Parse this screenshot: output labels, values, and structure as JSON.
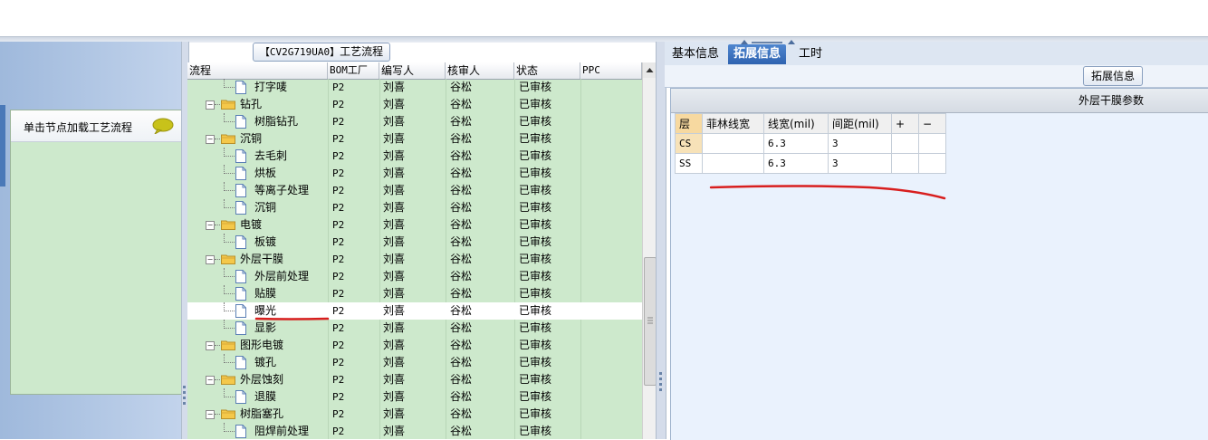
{
  "middle": {
    "title_code": "【CV2G719UA0】",
    "title_text": "工艺流程",
    "columns": [
      "流程",
      "BOM工厂",
      "编写人",
      "核审人",
      "状态",
      "PPC"
    ],
    "rows": [
      {
        "name": "打字唛",
        "level": 2,
        "kind": "doc",
        "bom": "P2",
        "writer": "刘喜",
        "reviewer": "谷松",
        "status": "已审核"
      },
      {
        "name": "钻孔",
        "level": 1,
        "kind": "folder",
        "bom": "P2",
        "writer": "刘喜",
        "reviewer": "谷松",
        "status": "已审核"
      },
      {
        "name": "树脂钻孔",
        "level": 2,
        "kind": "doc",
        "bom": "P2",
        "writer": "刘喜",
        "reviewer": "谷松",
        "status": "已审核"
      },
      {
        "name": "沉铜",
        "level": 1,
        "kind": "folder",
        "bom": "P2",
        "writer": "刘喜",
        "reviewer": "谷松",
        "status": "已审核"
      },
      {
        "name": "去毛刺",
        "level": 2,
        "kind": "doc",
        "bom": "P2",
        "writer": "刘喜",
        "reviewer": "谷松",
        "status": "已审核"
      },
      {
        "name": "烘板",
        "level": 2,
        "kind": "doc",
        "bom": "P2",
        "writer": "刘喜",
        "reviewer": "谷松",
        "status": "已审核"
      },
      {
        "name": "等离子处理",
        "level": 2,
        "kind": "doc",
        "bom": "P2",
        "writer": "刘喜",
        "reviewer": "谷松",
        "status": "已审核"
      },
      {
        "name": "沉铜",
        "level": 2,
        "kind": "doc",
        "bom": "P2",
        "writer": "刘喜",
        "reviewer": "谷松",
        "status": "已审核"
      },
      {
        "name": "电镀",
        "level": 1,
        "kind": "folder",
        "bom": "P2",
        "writer": "刘喜",
        "reviewer": "谷松",
        "status": "已审核"
      },
      {
        "name": "板镀",
        "level": 2,
        "kind": "doc",
        "bom": "P2",
        "writer": "刘喜",
        "reviewer": "谷松",
        "status": "已审核"
      },
      {
        "name": "外层干膜",
        "level": 1,
        "kind": "folder",
        "bom": "P2",
        "writer": "刘喜",
        "reviewer": "谷松",
        "status": "已审核"
      },
      {
        "name": "外层前处理",
        "level": 2,
        "kind": "doc",
        "bom": "P2",
        "writer": "刘喜",
        "reviewer": "谷松",
        "status": "已审核"
      },
      {
        "name": "贴膜",
        "level": 2,
        "kind": "doc",
        "bom": "P2",
        "writer": "刘喜",
        "reviewer": "谷松",
        "status": "已审核"
      },
      {
        "name": "曝光",
        "level": 2,
        "kind": "doc",
        "bom": "P2",
        "writer": "刘喜",
        "reviewer": "谷松",
        "status": "已审核",
        "selected": true
      },
      {
        "name": "显影",
        "level": 2,
        "kind": "doc",
        "bom": "P2",
        "writer": "刘喜",
        "reviewer": "谷松",
        "status": "已审核"
      },
      {
        "name": "图形电镀",
        "level": 1,
        "kind": "folder",
        "bom": "P2",
        "writer": "刘喜",
        "reviewer": "谷松",
        "status": "已审核"
      },
      {
        "name": "镀孔",
        "level": 2,
        "kind": "doc",
        "bom": "P2",
        "writer": "刘喜",
        "reviewer": "谷松",
        "status": "已审核"
      },
      {
        "name": "外层蚀刻",
        "level": 1,
        "kind": "folder",
        "bom": "P2",
        "writer": "刘喜",
        "reviewer": "谷松",
        "status": "已审核"
      },
      {
        "name": "退膜",
        "level": 2,
        "kind": "doc",
        "bom": "P2",
        "writer": "刘喜",
        "reviewer": "谷松",
        "status": "已审核"
      },
      {
        "name": "树脂塞孔",
        "level": 1,
        "kind": "folder",
        "bom": "P2",
        "writer": "刘喜",
        "reviewer": "谷松",
        "status": "已审核"
      },
      {
        "name": "阻焊前处理",
        "level": 2,
        "kind": "doc",
        "bom": "P2",
        "writer": "刘喜",
        "reviewer": "谷松",
        "status": "已审核"
      }
    ]
  },
  "left": {
    "card_label": "单击节点加载工艺流程",
    "icon": "speech-bubble-icon"
  },
  "right": {
    "tabs": [
      {
        "label": "基本信息",
        "active": false
      },
      {
        "label": "拓展信息",
        "active": true
      },
      {
        "label": "工时",
        "active": false
      }
    ],
    "ext_button": "拓展信息",
    "section_title": "外层干膜参数",
    "table": {
      "headers": [
        "层",
        "菲林线宽",
        "线宽(mil)",
        "间距(mil)",
        "+",
        "−"
      ],
      "rows": [
        {
          "layer": "CS",
          "film": "",
          "width": "6.3",
          "spacing": "3"
        },
        {
          "layer": "SS",
          "film": "",
          "width": "6.3",
          "spacing": "3"
        }
      ]
    }
  },
  "colors": {
    "row_green": "#cde9cc",
    "tab_active": "#3a70bd",
    "annotation_red": "#d81e1e"
  }
}
